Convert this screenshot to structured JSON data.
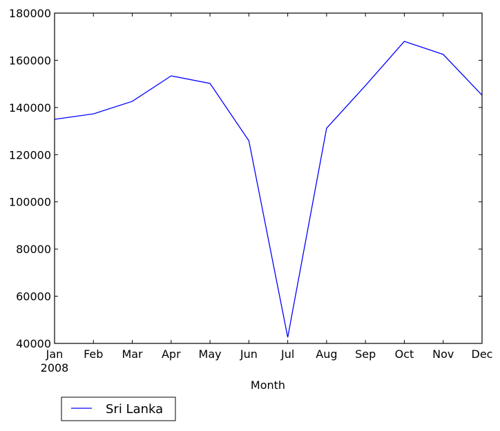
{
  "chart_data": {
    "type": "line",
    "title": "",
    "xlabel": "Month",
    "ylabel": "",
    "categories": [
      "Jan",
      "Feb",
      "Mar",
      "Apr",
      "May",
      "Jun",
      "Jul",
      "Aug",
      "Sep",
      "Oct",
      "Nov",
      "Dec"
    ],
    "x_tick_sublabel": "2008",
    "ylim": [
      40000,
      180000
    ],
    "yticks": [
      40000,
      60000,
      80000,
      100000,
      120000,
      140000,
      160000,
      180000
    ],
    "ytick_labels": [
      "40000",
      "60000",
      "80000",
      "100000",
      "120000",
      "140000",
      "160000",
      "180000"
    ],
    "grid": false,
    "legend_position": "bottom-left, outside below axes",
    "series": [
      {
        "name": "Sri Lanka",
        "color": "#0000ff",
        "values": [
          135000,
          137300,
          142600,
          153400,
          150200,
          125900,
          42600,
          131200,
          149300,
          168000,
          162500,
          145200
        ]
      }
    ]
  }
}
